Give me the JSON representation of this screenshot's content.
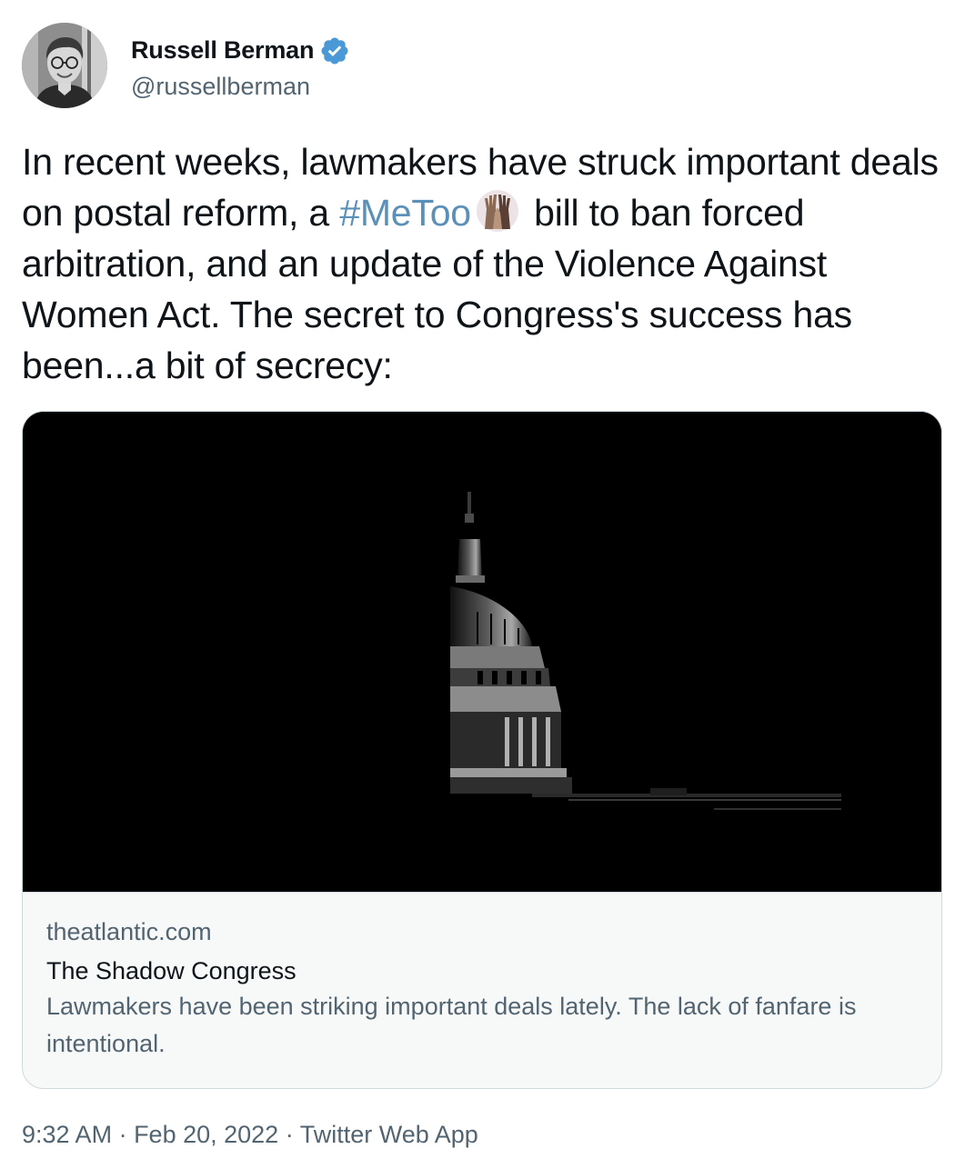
{
  "author": {
    "display_name": "Russell Berman",
    "handle": "@russellberman",
    "verified_icon": "verified-badge",
    "avatar_icon": "profile-photo"
  },
  "tweet": {
    "text_before_hashtag": "In recent weeks, lawmakers have struck important deals on postal reform, a ",
    "hashtag": "#MeToo",
    "hashtag_emoji_icon": "raised-hands-emoji",
    "text_after_hashtag": " bill to ban forced arbitration, and an update of the Violence Against Women Act. The secret to Congress's success has been...a bit of secrecy:"
  },
  "card": {
    "image_icon": "capitol-dome-in-shadow",
    "domain": "theatlantic.com",
    "title": "The Shadow Congress",
    "description": "Lawmakers have been striking important deals lately. The lack of fanfare is intentional."
  },
  "meta": {
    "time": "9:32 AM",
    "separator": " · ",
    "date": "Feb 20, 2022",
    "source": "Twitter Web App"
  },
  "colors": {
    "text": "#0f1419",
    "secondary": "#536471",
    "hashtag": "#5b90b8",
    "verified": "#4a99d6",
    "card_border": "#cfd9de"
  }
}
